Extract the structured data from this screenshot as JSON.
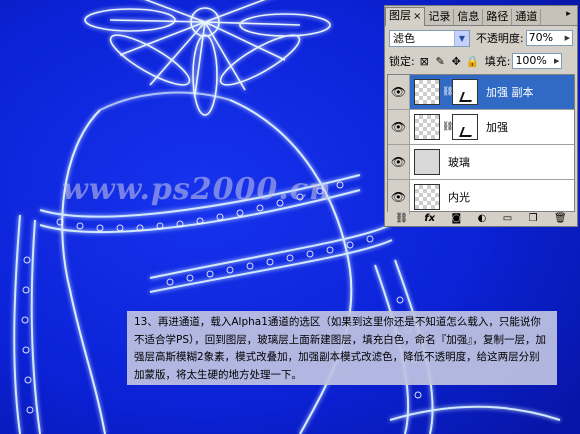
{
  "watermark": "www.ps2000.cn",
  "panel": {
    "tabs": [
      {
        "label": "图层",
        "close": "×"
      },
      {
        "label": "记录"
      },
      {
        "label": "信息"
      },
      {
        "label": "路径"
      },
      {
        "label": "通道"
      }
    ],
    "blend_mode": "滤色",
    "opacity_label": "不透明度:",
    "opacity_value": "70%",
    "lock_label": "锁定:",
    "fill_label": "填充:",
    "fill_value": "100%",
    "layers": [
      {
        "name": "加强 副本",
        "selected": true,
        "thumb": "transparent",
        "has_mask": true
      },
      {
        "name": "加强",
        "selected": false,
        "thumb": "transparent",
        "has_mask": true
      },
      {
        "name": "玻璃",
        "selected": false,
        "thumb": "glass",
        "has_mask": false
      },
      {
        "name": "内光",
        "selected": false,
        "thumb": "transparent",
        "has_mask": false
      }
    ],
    "bottom_icons": [
      "link-icon",
      "fx-icon",
      "mask-icon",
      "adjustment-icon",
      "group-icon",
      "new-layer-icon",
      "trash-icon"
    ]
  },
  "caption": "13、再进通道，载入Alpha1通道的选区（如果到这里你还是不知道怎么载入，只能说你不适合学PS），回到图层，玻璃层上面新建图层，填充白色，命名『加强』，复制一层，加强层高斯模糊2象素，模式改叠加，加强副本模式改滤色，降低不透明度，给这两层分别加蒙版，将太生硬的地方处理一下。",
  "colors": {
    "background": "#0a1fd8",
    "glow": "#bfe3ff",
    "selection": "#316ac5"
  }
}
